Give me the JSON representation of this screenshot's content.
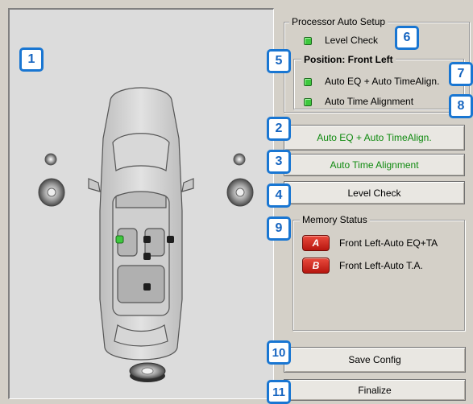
{
  "processor_group": {
    "title": "Processor Auto Setup",
    "level_check_label": "Level Check",
    "position_label": "Position: Front Left",
    "auto_eq_ta_label": "Auto EQ + Auto TimeAlign.",
    "auto_ta_label": "Auto Time Alignment"
  },
  "buttons": {
    "auto_eq_ta": "Auto EQ + Auto TimeAlign.",
    "auto_ta": "Auto Time Alignment",
    "level_check": "Level Check",
    "save_config": "Save Config",
    "finalize": "Finalize"
  },
  "memory": {
    "title": "Memory Status",
    "slots": [
      {
        "letter": "A",
        "label": "Front Left-Auto EQ+TA"
      },
      {
        "letter": "B",
        "label": "Front Left-Auto T.A."
      }
    ]
  },
  "callouts": [
    "1",
    "2",
    "3",
    "4",
    "5",
    "6",
    "7",
    "8",
    "9",
    "10",
    "11"
  ],
  "colors": {
    "window_bg": "#d4d0c8",
    "led_active": "#3ec83e",
    "button_green_text": "#0f8a0f",
    "badge_border": "#1976d2",
    "memory_slot_red": "#c8261b"
  }
}
